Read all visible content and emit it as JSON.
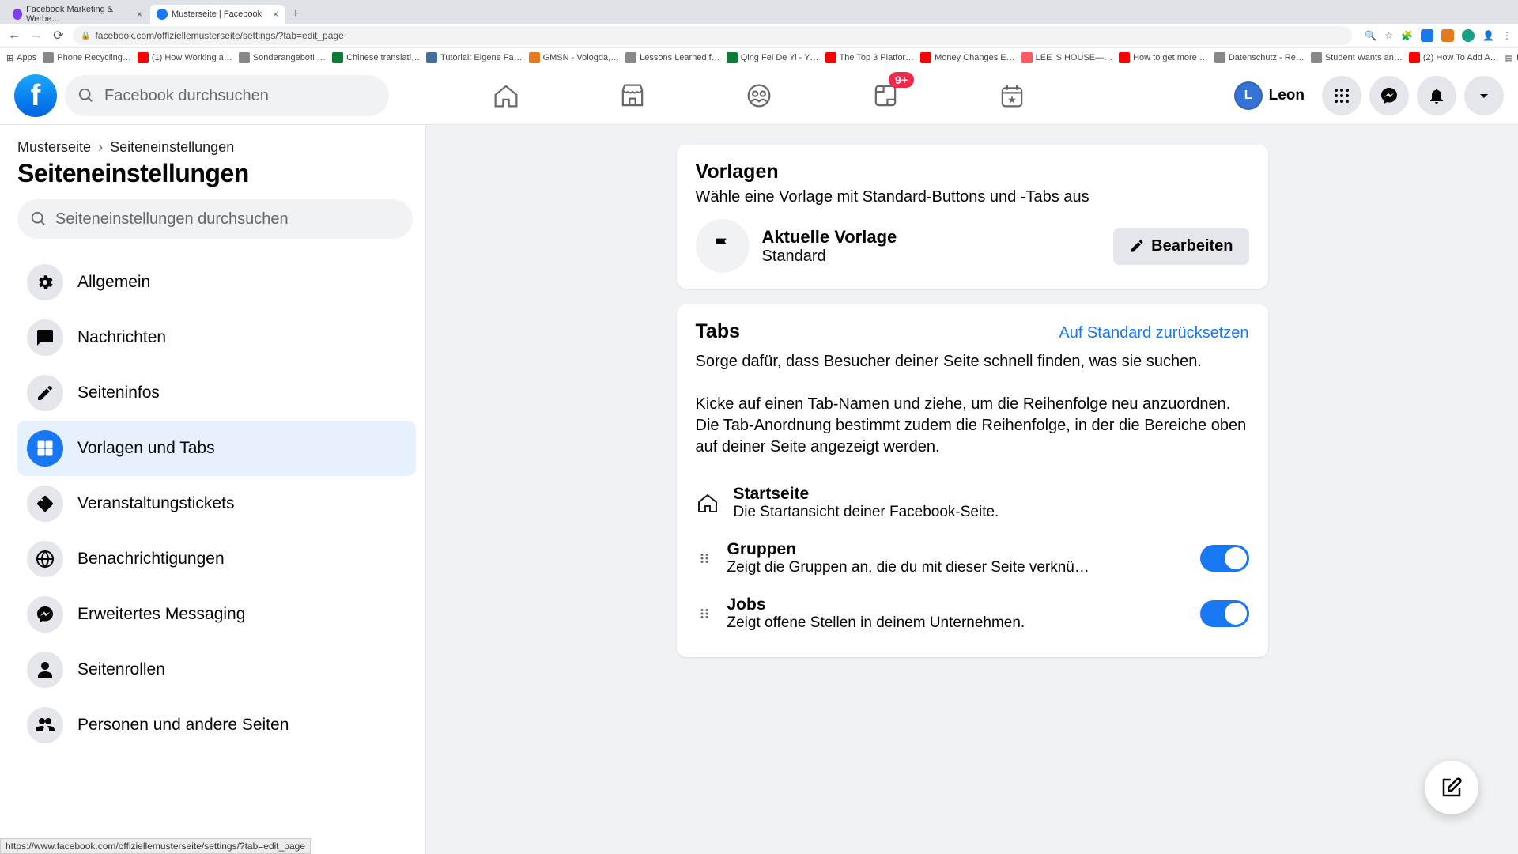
{
  "browser": {
    "tabs": [
      {
        "title": "Facebook Marketing & Werbe…",
        "favicon": "#7e3ff2",
        "active": false
      },
      {
        "title": "Musterseite | Facebook",
        "favicon": "#1877f2",
        "active": true
      }
    ],
    "url": "facebook.com/offiziellemusterseite/settings/?tab=edit_page",
    "bookmarks": [
      {
        "label": "Apps",
        "color": "#5f6368"
      },
      {
        "label": "Phone Recycling…",
        "color": "#888"
      },
      {
        "label": "(1) How Working a…",
        "color": "#f00"
      },
      {
        "label": "Sonderangebot! …",
        "color": "#888"
      },
      {
        "label": "Chinese translati…",
        "color": "#0a7d36"
      },
      {
        "label": "Tutorial: Eigene Fa…",
        "color": "#4470a0"
      },
      {
        "label": "GMSN - Vologda,…",
        "color": "#e37b1c"
      },
      {
        "label": "Lessons Learned f…",
        "color": "#888"
      },
      {
        "label": "Qing Fei De Yi - Y…",
        "color": "#0a7d36"
      },
      {
        "label": "The Top 3 Platfor…",
        "color": "#f00"
      },
      {
        "label": "Money Changes E…",
        "color": "#f00"
      },
      {
        "label": "LEE 'S HOUSE—…",
        "color": "#ff5a5f"
      },
      {
        "label": "How to get more …",
        "color": "#f00"
      },
      {
        "label": "Datenschutz - Re…",
        "color": "#888"
      },
      {
        "label": "Student Wants an…",
        "color": "#888"
      },
      {
        "label": "(2) How To Add A…",
        "color": "#f00"
      }
    ],
    "reading_list": "Leseliste",
    "status_url": "https://www.facebook.com/offiziellemusterseite/settings/?tab=edit_page"
  },
  "header": {
    "search_placeholder": "Facebook durchsuchen",
    "badge": "9+",
    "username": "Leon"
  },
  "sidebar": {
    "breadcrumb": {
      "root": "Musterseite",
      "current": "Seiteneinstellungen"
    },
    "title": "Seiteneinstellungen",
    "search_placeholder": "Seiteneinstellungen durchsuchen",
    "items": [
      {
        "label": "Allgemein",
        "icon": "gear",
        "active": false
      },
      {
        "label": "Nachrichten",
        "icon": "chat",
        "active": false
      },
      {
        "label": "Seiteninfos",
        "icon": "pencil",
        "active": false
      },
      {
        "label": "Vorlagen und Tabs",
        "icon": "grid",
        "active": true
      },
      {
        "label": "Veranstaltungstickets",
        "icon": "ticket",
        "active": false
      },
      {
        "label": "Benachrichtigungen",
        "icon": "globe",
        "active": false
      },
      {
        "label": "Erweitertes Messaging",
        "icon": "messenger",
        "active": false
      },
      {
        "label": "Seitenrollen",
        "icon": "person",
        "active": false
      },
      {
        "label": "Personen und andere Seiten",
        "icon": "people",
        "active": false
      }
    ]
  },
  "main": {
    "templates": {
      "title": "Vorlagen",
      "subtitle": "Wähle eine Vorlage mit Standard-Buttons und -Tabs aus",
      "current_label": "Aktuelle Vorlage",
      "current_value": "Standard",
      "edit": "Bearbeiten"
    },
    "tabs_card": {
      "title": "Tabs",
      "reset": "Auf Standard zurücksetzen",
      "desc1": "Sorge dafür, dass Besucher deiner Seite schnell finden, was sie suchen.",
      "desc2": "Kicke auf einen Tab-Namen und ziehe, um die Reihenfolge neu anzuordnen. Die Tab-Anordnung bestimmt zudem die Reihenfolge, in der die Bereiche oben auf deiner Seite angezeigt werden.",
      "rows": [
        {
          "name": "Startseite",
          "desc": "Die Startansicht deiner Facebook-Seite.",
          "draggable": false,
          "toggle": null
        },
        {
          "name": "Gruppen",
          "desc": "Zeigt die Gruppen an, die du mit dieser Seite verknü…",
          "draggable": true,
          "toggle": true
        },
        {
          "name": "Jobs",
          "desc": "Zeigt offene Stellen in deinem Unternehmen.",
          "draggable": true,
          "toggle": true
        }
      ]
    }
  }
}
